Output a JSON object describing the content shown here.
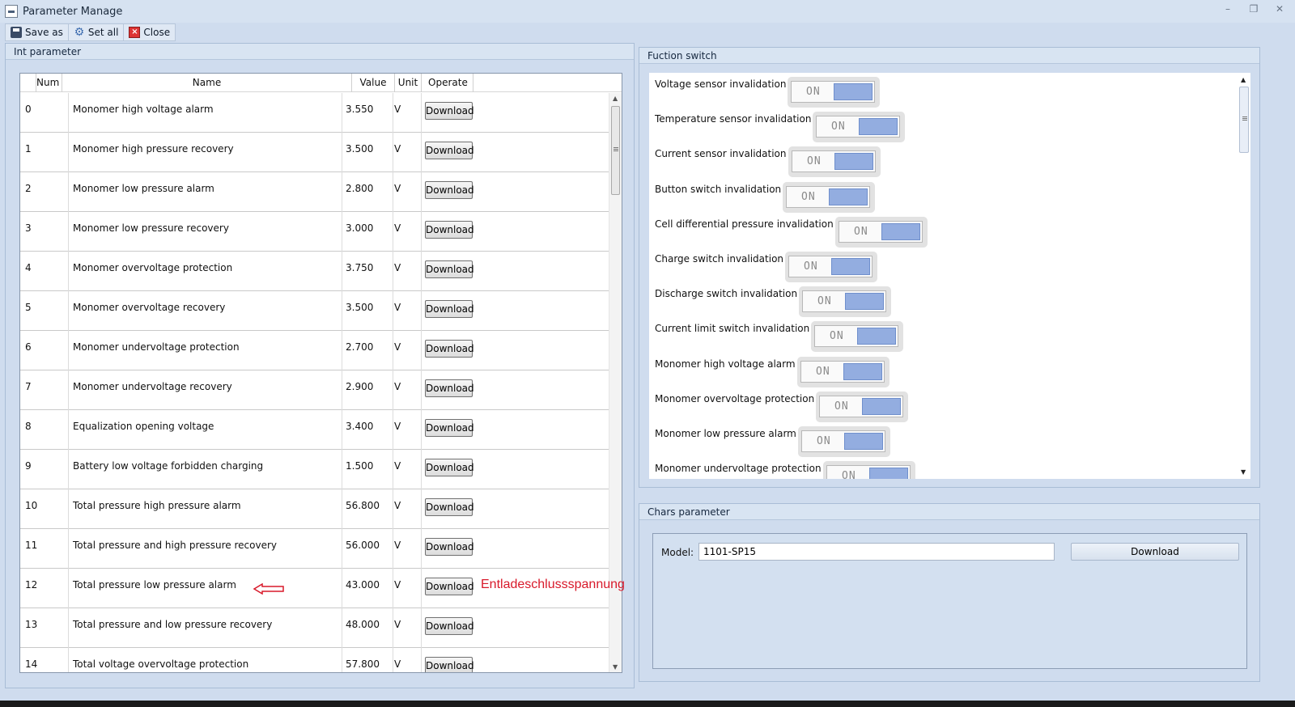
{
  "window": {
    "title": "Parameter Manage"
  },
  "toolbar": {
    "save_as": "Save as",
    "set_all": "Set all",
    "close": "Close"
  },
  "int_param": {
    "group_title": "Int parameter",
    "columns": {
      "num": "Num",
      "name": "Name",
      "value": "Value",
      "unit": "Unit",
      "operate": "Operate"
    },
    "rows": [
      {
        "num": "0",
        "name": "Monomer high voltage alarm",
        "value": "3.550",
        "unit": "V",
        "button": "Download"
      },
      {
        "num": "1",
        "name": "Monomer high pressure recovery",
        "value": "3.500",
        "unit": "V",
        "button": "Download"
      },
      {
        "num": "2",
        "name": "Monomer low pressure alarm",
        "value": "2.800",
        "unit": "V",
        "button": "Download"
      },
      {
        "num": "3",
        "name": "Monomer low pressure recovery",
        "value": "3.000",
        "unit": "V",
        "button": "Download"
      },
      {
        "num": "4",
        "name": "Monomer overvoltage protection",
        "value": "3.750",
        "unit": "V",
        "button": "Download"
      },
      {
        "num": "5",
        "name": "Monomer overvoltage recovery",
        "value": "3.500",
        "unit": "V",
        "button": "Download"
      },
      {
        "num": "6",
        "name": "Monomer undervoltage protection",
        "value": "2.700",
        "unit": "V",
        "button": "Download"
      },
      {
        "num": "7",
        "name": "Monomer undervoltage recovery",
        "value": "2.900",
        "unit": "V",
        "button": "Download"
      },
      {
        "num": "8",
        "name": "Equalization opening voltage",
        "value": "3.400",
        "unit": "V",
        "button": "Download"
      },
      {
        "num": "9",
        "name": "Battery low voltage forbidden charging",
        "value": "1.500",
        "unit": "V",
        "button": "Download"
      },
      {
        "num": "10",
        "name": "Total pressure high pressure alarm",
        "value": "56.800",
        "unit": "V",
        "button": "Download"
      },
      {
        "num": "11",
        "name": "Total pressure and high pressure recovery",
        "value": "56.000",
        "unit": "V",
        "button": "Download"
      },
      {
        "num": "12",
        "name": "Total pressure low pressure alarm",
        "value": "43.000",
        "unit": "V",
        "button": "Download"
      },
      {
        "num": "13",
        "name": "Total pressure and low pressure recovery",
        "value": "48.000",
        "unit": "V",
        "button": "Download"
      },
      {
        "num": "14",
        "name": "Total voltage overvoltage protection",
        "value": "57.800",
        "unit": "V",
        "button": "Download"
      }
    ],
    "annotation": "Entladeschlussspannung"
  },
  "function_switch": {
    "group_title": "Fuction switch",
    "items": [
      {
        "label": "Voltage sensor invalidation",
        "state": "ON"
      },
      {
        "label": "Temperature sensor invalidation",
        "state": "ON"
      },
      {
        "label": "Current sensor invalidation",
        "state": "ON"
      },
      {
        "label": "Button switch invalidation",
        "state": "ON"
      },
      {
        "label": "Cell differential pressure invalidation",
        "state": "ON"
      },
      {
        "label": "Charge switch invalidation",
        "state": "ON"
      },
      {
        "label": "Discharge switch invalidation",
        "state": "ON"
      },
      {
        "label": "Current limit switch invalidation",
        "state": "ON"
      },
      {
        "label": "Monomer high voltage alarm",
        "state": "ON"
      },
      {
        "label": "Monomer overvoltage protection",
        "state": "ON"
      },
      {
        "label": "Monomer low pressure alarm",
        "state": "ON"
      },
      {
        "label": "Monomer undervoltage protection",
        "state": "ON"
      }
    ]
  },
  "chars_param": {
    "group_title": "Chars parameter",
    "model_label": "Model:",
    "model_value": "1101-SP15",
    "download": "Download"
  },
  "colors": {
    "annotation": "#d8192a",
    "toggle_knob": "#93ade0",
    "panel_bg": "#cfdcee"
  }
}
